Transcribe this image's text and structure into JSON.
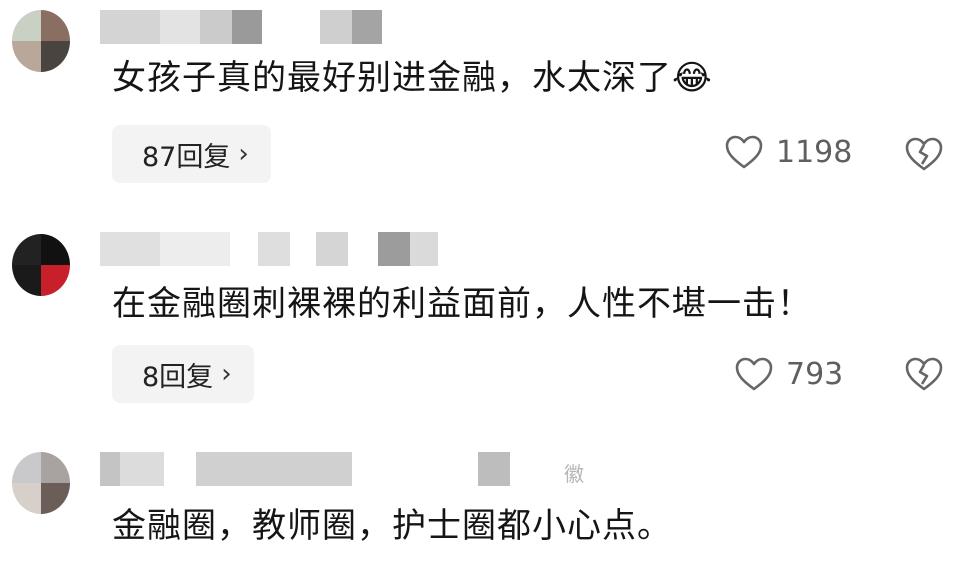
{
  "comments": [
    {
      "text": "女孩子真的最好别进金融，水太深了",
      "emoji": "😂",
      "reply_label": "87回复",
      "likes": "1198"
    },
    {
      "text": "在金融圈刺裸裸的利益面前，人性不堪一击！",
      "reply_label": "8回复",
      "likes": "793"
    },
    {
      "text": "金融圈，教师圈，护士圈都小心点。",
      "region": "徽"
    }
  ],
  "icons": {
    "like": "heart-outline-icon",
    "dislike": "broken-heart-icon",
    "chevron": "chevron-right-icon"
  }
}
